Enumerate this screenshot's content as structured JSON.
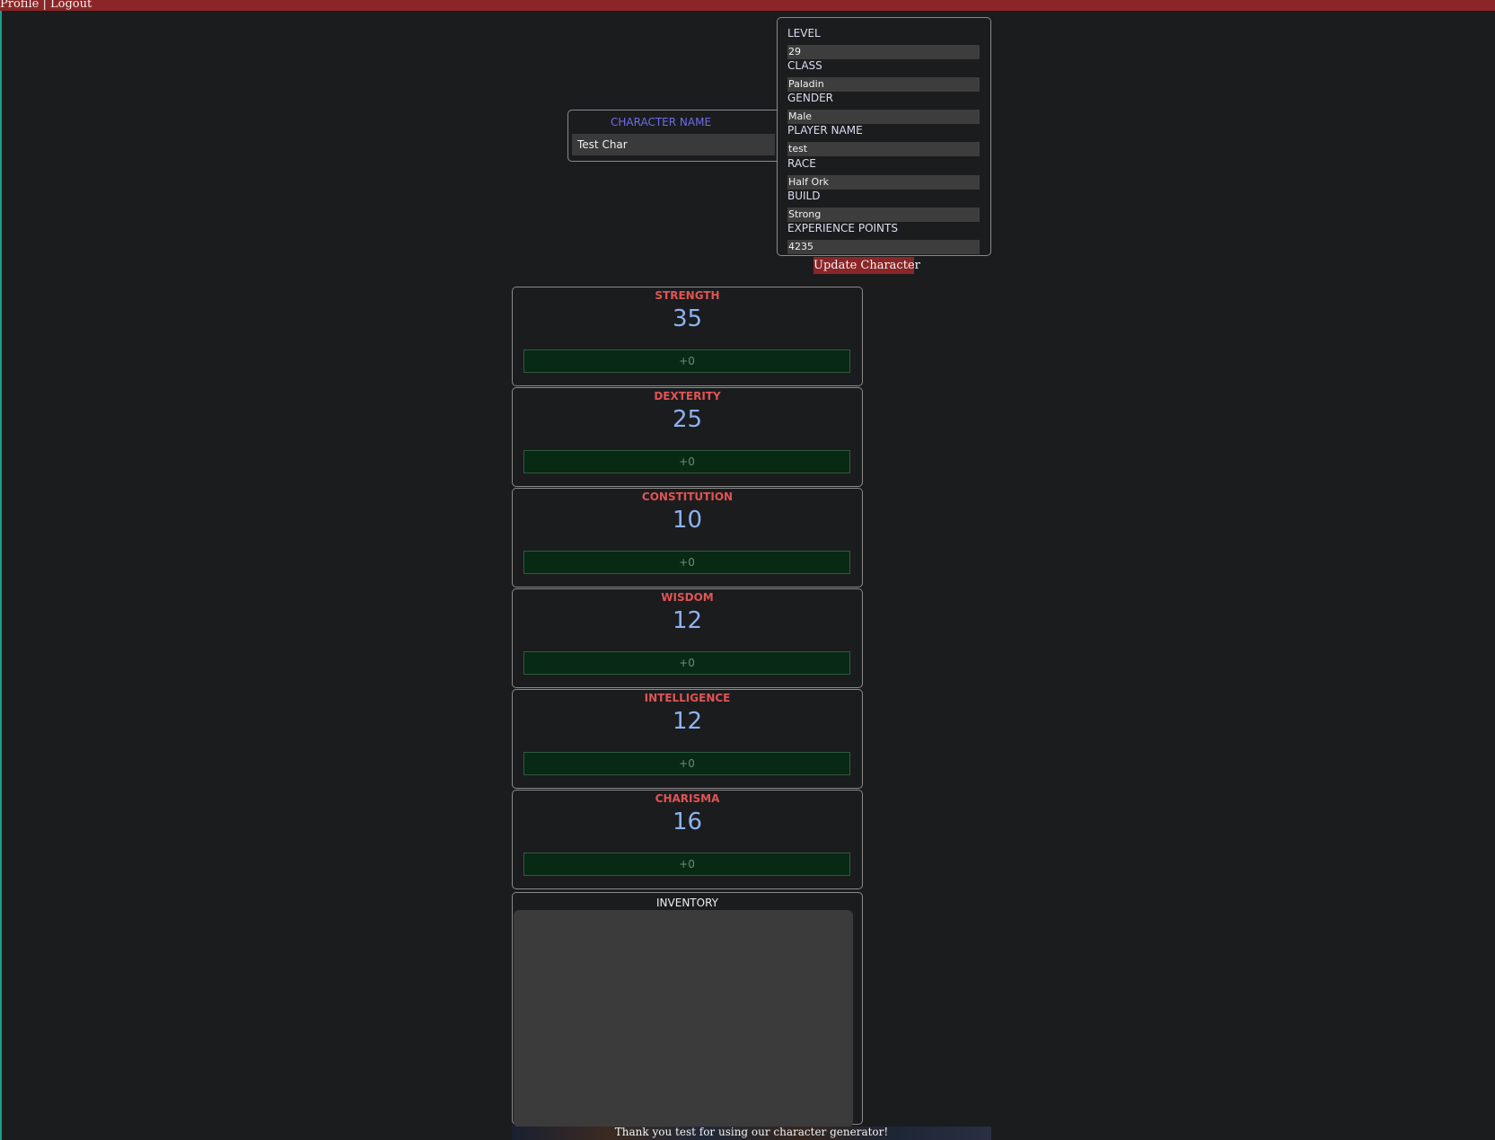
{
  "nav": {
    "profile": "Profile",
    "separator": "|",
    "logout": "Logout"
  },
  "character_name": {
    "label": "CHARACTER NAME",
    "value": "Test Char"
  },
  "details": [
    {
      "label": "LEVEL",
      "value": "29"
    },
    {
      "label": "CLASS",
      "value": "Paladin"
    },
    {
      "label": "GENDER",
      "value": "Male"
    },
    {
      "label": "PLAYER NAME",
      "value": "test"
    },
    {
      "label": "RACE",
      "value": "Half Ork"
    },
    {
      "label": "BUILD",
      "value": "Strong"
    },
    {
      "label": "EXPERIENCE POINTS",
      "value": "4235"
    }
  ],
  "update_button": "Update Character",
  "stats": [
    {
      "name": "STRENGTH",
      "value": "35",
      "modifier": "+0"
    },
    {
      "name": "DEXTERITY",
      "value": "25",
      "modifier": "+0"
    },
    {
      "name": "CONSTITUTION",
      "value": "10",
      "modifier": "+0"
    },
    {
      "name": "WISDOM",
      "value": "12",
      "modifier": "+0"
    },
    {
      "name": "INTELLIGENCE",
      "value": "12",
      "modifier": "+0"
    },
    {
      "name": "CHARISMA",
      "value": "16",
      "modifier": "+0"
    }
  ],
  "inventory": {
    "label": "INVENTORY",
    "value": ""
  },
  "footer": "Thank you test for using our character generator!",
  "colors": {
    "header_bar": "#8b2527",
    "background": "#1b1c1e",
    "stat_name": "#e05454",
    "stat_value": "#8db2f0",
    "modifier_bg": "#082914",
    "name_label": "#6f6de8"
  }
}
